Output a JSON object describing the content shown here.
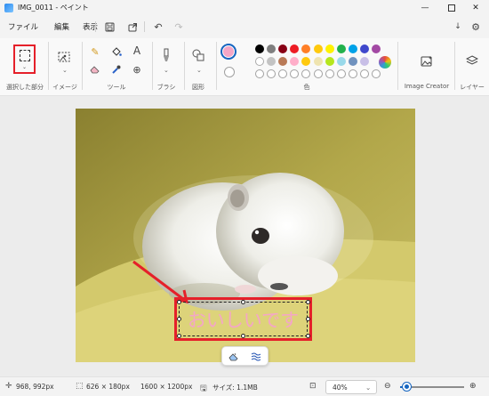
{
  "window": {
    "title": "IMG_0011 - ペイント",
    "minimize_icon": "minimize-icon",
    "maximize_icon": "maximize-icon",
    "close_icon": "close-icon"
  },
  "menu": {
    "file": "ファイル",
    "edit": "編集",
    "view": "表示",
    "icons": [
      "save-icon",
      "share-icon",
      "undo-icon",
      "redo-icon",
      "download-icon",
      "settings-icon"
    ]
  },
  "ribbon": {
    "selection_label": "選択した部分",
    "image_label": "イメージ",
    "tools_label": "ツール",
    "brush_label": "ブラシ",
    "shapes_label": "図形",
    "colors_label": "色",
    "image_creator_label": "Image Creator",
    "layers_label": "レイヤー",
    "selected_color": "#f4a6c6",
    "palette_row1": [
      "#000000",
      "#7f7f7f",
      "#880015",
      "#ed1c24",
      "#ff7f27",
      "#ffc90e",
      "#fff200",
      "#22b14c",
      "#00a2e8",
      "#3f48cc",
      "#a349a4"
    ],
    "palette_row2": [
      "#ffffff",
      "#c3c3c3",
      "#b97a57",
      "#ffaec9",
      "#ffc90e",
      "#efe4b0",
      "#b5e61d",
      "#99d9ea",
      "#7092be",
      "#c8bfe7"
    ],
    "highlight_color": "#e5202a"
  },
  "canvas": {
    "text_value": "おいしいです",
    "text_color": "#f4a6c6",
    "float_toolbar_icons": [
      "eraser-icon",
      "transparency-icon"
    ]
  },
  "status": {
    "cursor_position": "968, 992px",
    "selection_size": "626 × 180px",
    "image_size": "1600 × 1200px",
    "file_size": "サイズ: 1.1MB",
    "zoom": "40%",
    "zoom_fraction": 0.4
  }
}
